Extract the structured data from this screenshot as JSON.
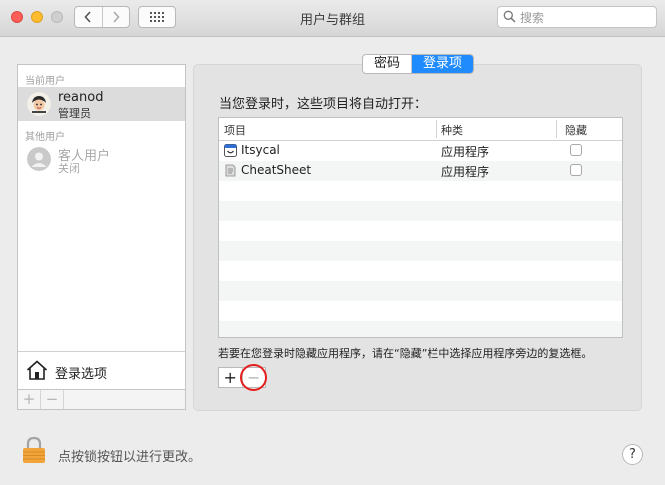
{
  "window": {
    "title": "用户与群组",
    "search_placeholder": "搜索"
  },
  "users": {
    "current_header": "当前用户",
    "other_header": "其他用户",
    "current": {
      "name": "reanod",
      "role": "管理员"
    },
    "guest": {
      "name": "客人用户",
      "status": "关闭"
    },
    "login_options": "登录选项",
    "add": "+",
    "remove": "−"
  },
  "tabs": [
    {
      "label": "密码",
      "selected": false
    },
    {
      "label": "登录项",
      "selected": true
    }
  ],
  "login_items": {
    "heading": "当您登录时，这些项目将自动打开：",
    "columns": [
      "项目",
      "种类",
      "隐藏"
    ],
    "rows": [
      {
        "name": "Itsycal",
        "type": "应用程序",
        "hidden": false,
        "icon": "itsycal-calendar-icon"
      },
      {
        "name": "CheatSheet",
        "type": "应用程序",
        "hidden": false,
        "icon": "cheatsheet-icon"
      }
    ],
    "hint": "若要在您登录时隐藏应用程序，请在“隐藏”栏中选择应用程序旁边的复选框。",
    "add": "+",
    "remove": "−"
  },
  "footer": {
    "lock_text": "点按锁按钮以进行更改。",
    "help": "?"
  },
  "colors": {
    "accent": "#1f8bfc",
    "annotation": "#e41d1d"
  }
}
